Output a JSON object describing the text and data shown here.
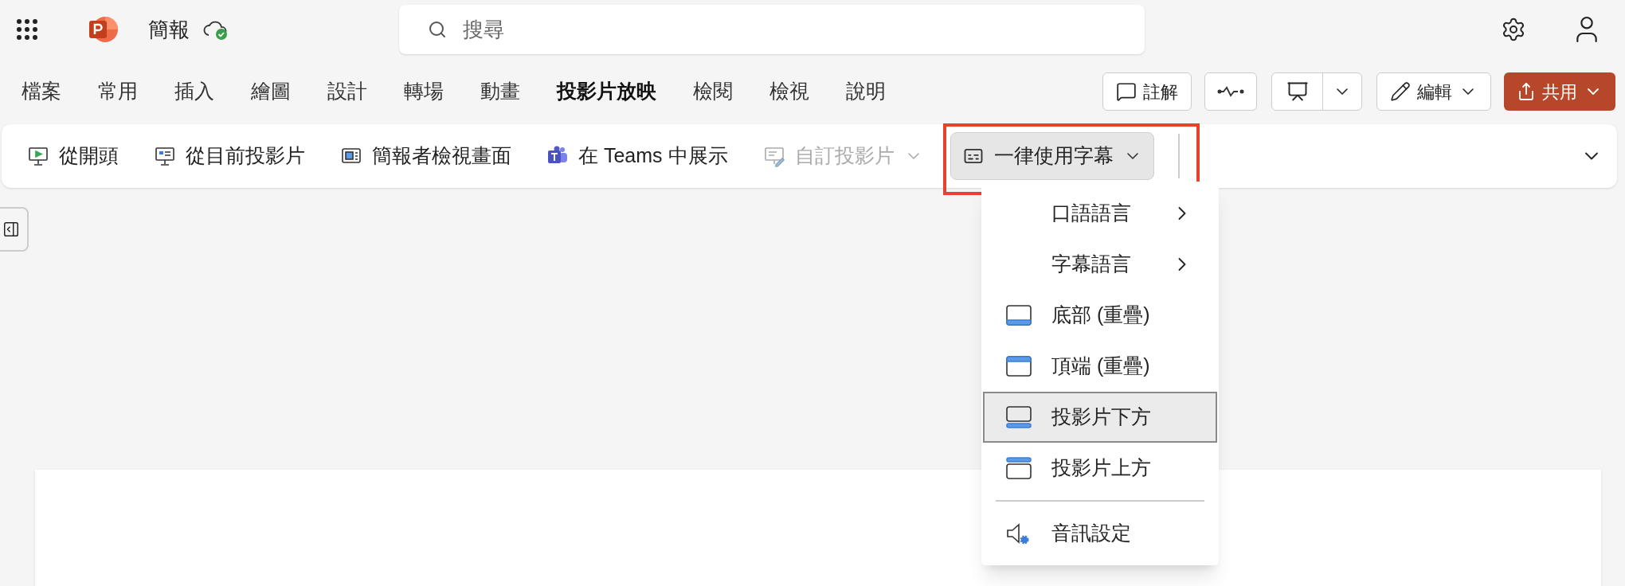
{
  "app": {
    "title": "簡報",
    "search": {
      "placeholder": "搜尋"
    }
  },
  "ribbon_tabs": [
    {
      "label": "檔案",
      "selected": false
    },
    {
      "label": "常用",
      "selected": false
    },
    {
      "label": "插入",
      "selected": false
    },
    {
      "label": "繪圖",
      "selected": false
    },
    {
      "label": "設計",
      "selected": false
    },
    {
      "label": "轉場",
      "selected": false
    },
    {
      "label": "動畫",
      "selected": false
    },
    {
      "label": "投影片放映",
      "selected": true
    },
    {
      "label": "檢閱",
      "selected": false
    },
    {
      "label": "檢視",
      "selected": false
    },
    {
      "label": "說明",
      "selected": false
    }
  ],
  "header_buttons": {
    "comments": "註解",
    "edit": "編輯",
    "share": "共用"
  },
  "toolbar": [
    {
      "kind": "start",
      "label": "從開頭",
      "disabled": false,
      "dropdown": false,
      "open": false
    },
    {
      "kind": "current",
      "label": "從目前投影片",
      "disabled": false,
      "dropdown": false,
      "open": false
    },
    {
      "kind": "presenter",
      "label": "簡報者檢視畫面",
      "disabled": false,
      "dropdown": false,
      "open": false
    },
    {
      "kind": "teams",
      "label": "在 Teams 中展示",
      "disabled": false,
      "dropdown": false,
      "open": false
    },
    {
      "kind": "custom",
      "label": "自訂投影片",
      "disabled": true,
      "dropdown": true,
      "open": false
    },
    {
      "kind": "captions",
      "label": "一律使用字幕",
      "disabled": false,
      "dropdown": true,
      "open": true
    }
  ],
  "menu": [
    {
      "kind": "submenu",
      "label": "口語語言"
    },
    {
      "kind": "submenu",
      "label": "字幕語言"
    },
    {
      "kind": "bottom",
      "label": "底部 (重疊)",
      "selected": false
    },
    {
      "kind": "top",
      "label": "頂端 (重疊)",
      "selected": false
    },
    {
      "kind": "below",
      "label": "投影片下方",
      "selected": true
    },
    {
      "kind": "above",
      "label": "投影片上方",
      "selected": false
    },
    {
      "kind": "divider"
    },
    {
      "kind": "audio",
      "label": "音訊設定"
    }
  ]
}
